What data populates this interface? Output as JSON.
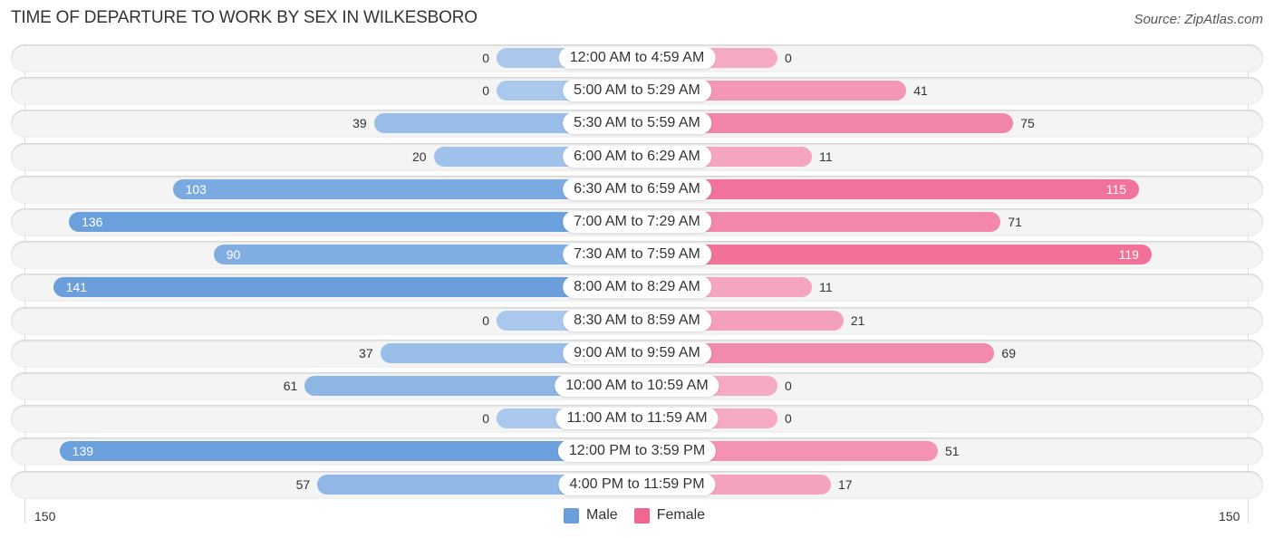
{
  "chart_data": {
    "type": "bar",
    "orientation": "horizontal-diverging",
    "title": "TIME OF DEPARTURE TO WORK BY SEX IN WILKESBORO",
    "source": "Source: ZipAtlas.com",
    "categories": [
      "12:00 AM to 4:59 AM",
      "5:00 AM to 5:29 AM",
      "5:30 AM to 5:59 AM",
      "6:00 AM to 6:29 AM",
      "6:30 AM to 6:59 AM",
      "7:00 AM to 7:29 AM",
      "7:30 AM to 7:59 AM",
      "8:00 AM to 8:29 AM",
      "8:30 AM to 8:59 AM",
      "9:00 AM to 9:59 AM",
      "10:00 AM to 10:59 AM",
      "11:00 AM to 11:59 AM",
      "12:00 PM to 3:59 PM",
      "4:00 PM to 11:59 PM"
    ],
    "series": [
      {
        "name": "Male",
        "color": "#6a9fdc",
        "values": [
          0,
          0,
          39,
          20,
          103,
          136,
          90,
          141,
          0,
          37,
          61,
          0,
          139,
          57
        ]
      },
      {
        "name": "Female",
        "color": "#f06792",
        "values": [
          0,
          41,
          75,
          11,
          115,
          71,
          119,
          11,
          21,
          69,
          0,
          0,
          51,
          17
        ]
      }
    ],
    "axis": {
      "left_label": "150",
      "right_label": "150",
      "max": 150
    },
    "legend": {
      "position": "bottom-center",
      "items": [
        "Male",
        "Female"
      ]
    }
  }
}
